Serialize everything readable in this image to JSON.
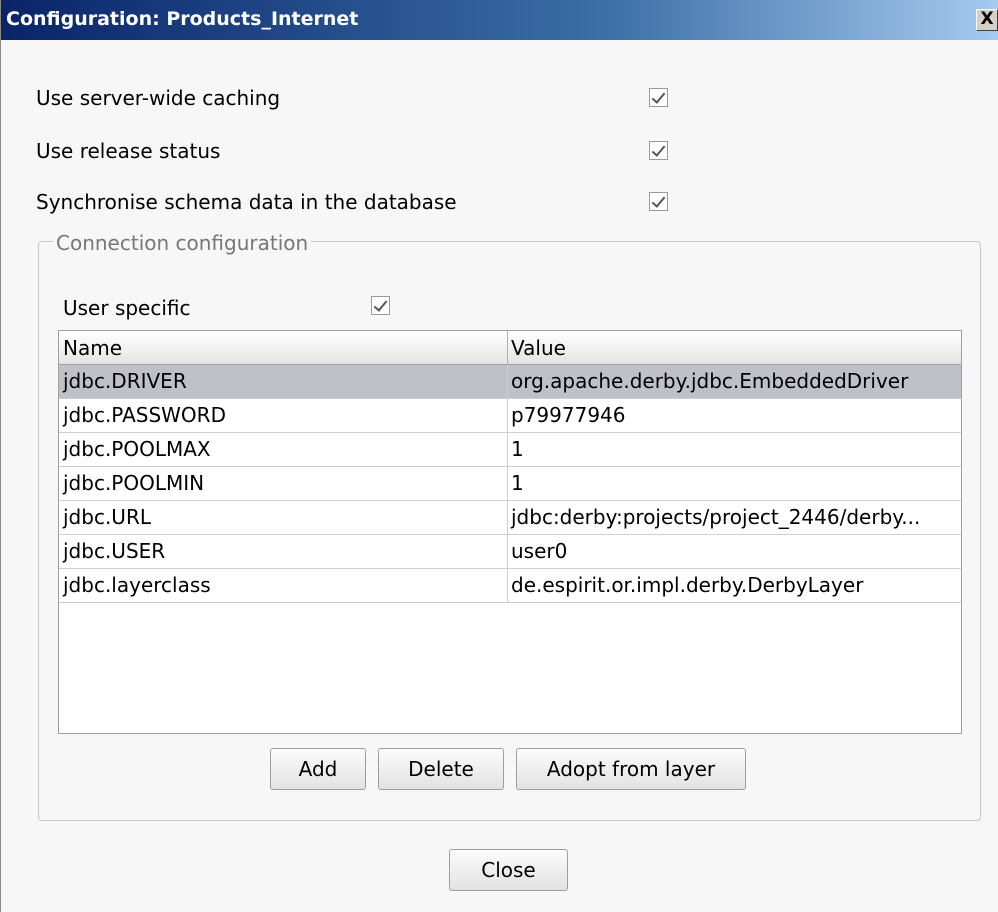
{
  "window": {
    "title": "Configuration: Products_Internet",
    "close_glyph": "X"
  },
  "options": [
    {
      "label": "Use server-wide caching",
      "checked": true
    },
    {
      "label": "Use release status",
      "checked": true
    },
    {
      "label": "Synchronise schema data in the database",
      "checked": true
    }
  ],
  "connection": {
    "legend": "Connection configuration",
    "user_specific_label": "User specific",
    "user_specific_checked": true,
    "columns": [
      "Name",
      "Value"
    ],
    "rows": [
      {
        "name": "jdbc.DRIVER",
        "value": "org.apache.derby.jdbc.EmbeddedDriver",
        "selected": true
      },
      {
        "name": "jdbc.PASSWORD",
        "value": "p79977946"
      },
      {
        "name": "jdbc.POOLMAX",
        "value": "1"
      },
      {
        "name": "jdbc.POOLMIN",
        "value": "1"
      },
      {
        "name": "jdbc.URL",
        "value": "jdbc:derby:projects/project_2446/derby..."
      },
      {
        "name": "jdbc.USER",
        "value": "user0"
      },
      {
        "name": "jdbc.layerclass",
        "value": "de.espirit.or.impl.derby.DerbyLayer"
      }
    ],
    "buttons": {
      "add": "Add",
      "delete": "Delete",
      "adopt": "Adopt from layer"
    }
  },
  "footer": {
    "close": "Close"
  }
}
